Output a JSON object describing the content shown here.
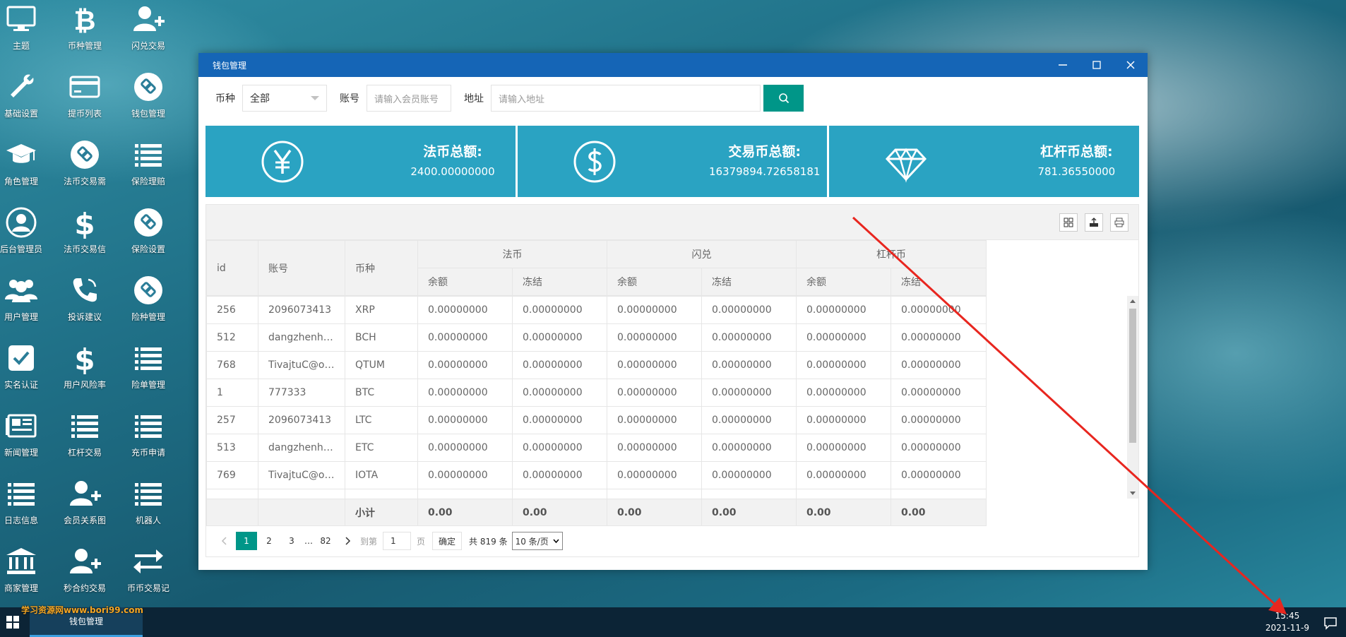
{
  "desktop": {
    "icons": [
      {
        "label": "主题",
        "icon": "monitor-icon"
      },
      {
        "label": "币种管理",
        "icon": "bitcoin-icon"
      },
      {
        "label": "闪兑交易",
        "icon": "user-plus-icon"
      },
      {
        "label": "基础设置",
        "icon": "wrench-icon"
      },
      {
        "label": "提币列表",
        "icon": "credit-card-icon"
      },
      {
        "label": "钱包管理",
        "icon": "link-circle-icon"
      },
      {
        "label": "角色管理",
        "icon": "graduation-cap-icon"
      },
      {
        "label": "法币交易需",
        "icon": "link-circle-icon"
      },
      {
        "label": "保险理赔",
        "icon": "list-icon"
      },
      {
        "label": "后台管理员",
        "icon": "user-circle-icon"
      },
      {
        "label": "法币交易信",
        "icon": "dollar-icon"
      },
      {
        "label": "保险设置",
        "icon": "link-circle-icon"
      },
      {
        "label": "用户管理",
        "icon": "users-icon"
      },
      {
        "label": "投诉建议",
        "icon": "phone-icon"
      },
      {
        "label": "险种管理",
        "icon": "link-circle-icon"
      },
      {
        "label": "实名认证",
        "icon": "check-square-icon"
      },
      {
        "label": "用户风险率",
        "icon": "dollar-icon"
      },
      {
        "label": "险单管理",
        "icon": "list-icon"
      },
      {
        "label": "新闻管理",
        "icon": "newspaper-icon"
      },
      {
        "label": "杠杆交易",
        "icon": "list-icon"
      },
      {
        "label": "充币申请",
        "icon": "list-icon"
      },
      {
        "label": "日志信息",
        "icon": "list-icon"
      },
      {
        "label": "会员关系图",
        "icon": "user-plus-icon"
      },
      {
        "label": "机器人",
        "icon": "list-icon"
      },
      {
        "label": "商家管理",
        "icon": "bank-icon"
      },
      {
        "label": "秒合约交易",
        "icon": "user-plus-icon"
      },
      {
        "label": "币币交易记",
        "icon": "exchange-icon"
      }
    ]
  },
  "window": {
    "title": "钱包管理",
    "filters": {
      "coin_label": "币种",
      "coin_value": "全部",
      "account_label": "账号",
      "account_placeholder": "请输入会员账号",
      "address_label": "地址",
      "address_placeholder": "请输入地址"
    },
    "stats": [
      {
        "title": "法币总额:",
        "value": "2400.00000000",
        "icon": "yen-icon"
      },
      {
        "title": "交易币总额:",
        "value": "16379894.72658181",
        "icon": "dollar-circle-icon"
      },
      {
        "title": "杠杆币总额:",
        "value": "781.36550000",
        "icon": "diamond-icon"
      }
    ],
    "table": {
      "headers": {
        "id": "id",
        "account": "账号",
        "coin": "币种",
        "group_fiat": "法币",
        "group_flash": "闪兑",
        "group_lever": "杠杆币",
        "balance": "余额",
        "frozen": "冻结"
      },
      "rows": [
        [
          "256",
          "2096073413",
          "XRP",
          "0.00000000",
          "0.00000000",
          "0.00000000",
          "0.00000000",
          "0.00000000",
          "0.00000000"
        ],
        [
          "512",
          "dangzhenh…",
          "BCH",
          "0.00000000",
          "0.00000000",
          "0.00000000",
          "0.00000000",
          "0.00000000",
          "0.00000000"
        ],
        [
          "768",
          "TivajtuC@o…",
          "QTUM",
          "0.00000000",
          "0.00000000",
          "0.00000000",
          "0.00000000",
          "0.00000000",
          "0.00000000"
        ],
        [
          "1",
          "777333",
          "BTC",
          "0.00000000",
          "0.00000000",
          "0.00000000",
          "0.00000000",
          "0.00000000",
          "0.00000000"
        ],
        [
          "257",
          "2096073413",
          "LTC",
          "0.00000000",
          "0.00000000",
          "0.00000000",
          "0.00000000",
          "0.00000000",
          "0.00000000"
        ],
        [
          "513",
          "dangzhenh…",
          "ETC",
          "0.00000000",
          "0.00000000",
          "0.00000000",
          "0.00000000",
          "0.00000000",
          "0.00000000"
        ],
        [
          "769",
          "TivajtuC@o…",
          "IOTA",
          "0.00000000",
          "0.00000000",
          "0.00000000",
          "0.00000000",
          "0.00000000",
          "0.00000000"
        ]
      ],
      "totals": {
        "label": "小计",
        "values": [
          "0.00",
          "0.00",
          "0.00",
          "0.00",
          "0.00",
          "0.00"
        ]
      }
    },
    "pagination": {
      "pages": [
        "1",
        "2",
        "3",
        "…",
        "82"
      ],
      "current": "1",
      "goto_label": "到第",
      "goto_value": "1",
      "page_unit": "页",
      "confirm": "确定",
      "total": "共 819 条",
      "per_page": "10 条/页"
    }
  },
  "taskbar": {
    "task": "钱包管理",
    "watermark": "学习资源网www.bori99.com",
    "time": "15:45",
    "date": "2021-11-9"
  },
  "colors": {
    "titlebar": "#1565b6",
    "stat_card": "#2aa3c2",
    "accent_green": "#009688",
    "annotation_arrow": "#e8261f"
  }
}
